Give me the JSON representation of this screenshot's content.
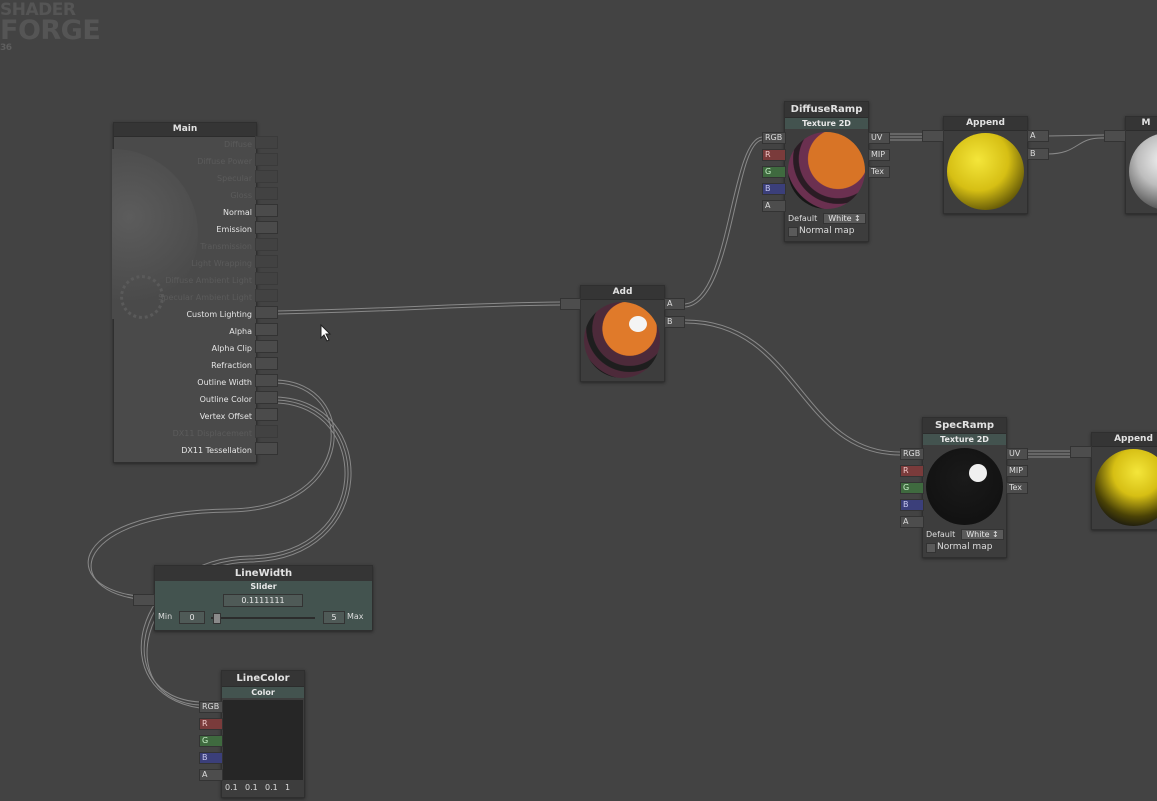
{
  "app": {
    "logo_line1": "SHADER",
    "logo_line2": "FORGE",
    "version": "36"
  },
  "main_node": {
    "title": "Main",
    "inputs": [
      {
        "label": "Diffuse",
        "active": false
      },
      {
        "label": "Diffuse Power",
        "active": false
      },
      {
        "label": "Specular",
        "active": false
      },
      {
        "label": "Gloss",
        "active": false
      },
      {
        "label": "Normal",
        "active": true
      },
      {
        "label": "Emission",
        "active": true
      },
      {
        "label": "Transmission",
        "active": false
      },
      {
        "label": "Light Wrapping",
        "active": false
      },
      {
        "label": "Diffuse Ambient Light",
        "active": false
      },
      {
        "label": "Specular Ambient Light",
        "active": false
      },
      {
        "label": "Custom Lighting",
        "active": true
      },
      {
        "label": "Alpha",
        "active": true
      },
      {
        "label": "Alpha Clip",
        "active": true
      },
      {
        "label": "Refraction",
        "active": true
      },
      {
        "label": "Outline Width",
        "active": true
      },
      {
        "label": "Outline Color",
        "active": true
      },
      {
        "label": "Vertex Offset",
        "active": true
      },
      {
        "label": "DX11 Displacement",
        "active": false
      },
      {
        "label": "DX11 Tessellation",
        "active": true
      }
    ]
  },
  "add_node": {
    "title": "Add",
    "in_a": "A",
    "in_b": "B"
  },
  "diffuse_ramp": {
    "title": "DiffuseRamp",
    "subtitle": "Texture 2D",
    "in_rgb": "RGB",
    "in_r": "R",
    "in_g": "G",
    "in_b": "B",
    "in_a": "A",
    "out_uv": "UV",
    "out_mip": "MIP",
    "out_tex": "Tex",
    "default_label": "Default",
    "default_value": "White",
    "normal_map_label": "Normal map"
  },
  "append_node_1": {
    "title": "Append",
    "out_a": "A",
    "out_b": "B"
  },
  "partial_node_top_right": {
    "title": "M"
  },
  "spec_ramp": {
    "title": "SpecRamp",
    "subtitle": "Texture 2D",
    "in_rgb": "RGB",
    "in_r": "R",
    "in_g": "G",
    "in_b": "B",
    "in_a": "A",
    "out_uv": "UV",
    "out_mip": "MIP",
    "out_tex": "Tex",
    "default_label": "Default",
    "default_value": "White",
    "normal_map_label": "Normal map"
  },
  "append_node_2": {
    "title": "Append"
  },
  "line_width": {
    "title": "LineWidth",
    "subtitle": "Slider",
    "value": "0.1111111",
    "min_label": "Min",
    "min_value": "0",
    "max_value": "5",
    "max_label": "Max",
    "slider_fraction": 0.022
  },
  "line_color": {
    "title": "LineColor",
    "subtitle": "Color",
    "in_rgb": "RGB",
    "in_r": "R",
    "in_g": "G",
    "in_b": "B",
    "in_a": "A",
    "r": "0.1",
    "g": "0.1",
    "b": "0.1",
    "a": "1"
  },
  "colors": {
    "background": "#434343",
    "wire": "#9a9a9a",
    "node_header": "#43534f",
    "orange": "#d87426",
    "yellow": "#e8d21a"
  }
}
